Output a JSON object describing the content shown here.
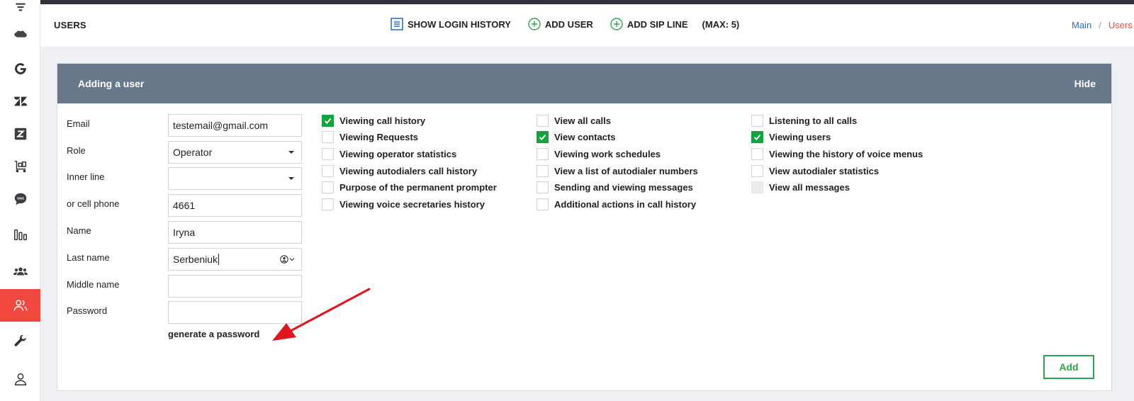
{
  "header": {
    "title": "USERS",
    "toolbar": {
      "show_login_history": "SHOW LOGIN HISTORY",
      "add_user": "ADD USER",
      "add_sip_line": "ADD SIP LINE",
      "max": "(MAX: 5)"
    },
    "breadcrumb": {
      "main": "Main",
      "separator": "/",
      "current": "Users"
    }
  },
  "panel": {
    "title": "Adding a user",
    "hide": "Hide",
    "form": {
      "email": {
        "label": "Email",
        "value": "testemail@gmail.com"
      },
      "role": {
        "label": "Role",
        "value": "Operator"
      },
      "inner_line": {
        "label": "Inner line",
        "value": ""
      },
      "cell_phone": {
        "label": "or cell phone",
        "value": "4661"
      },
      "name": {
        "label": "Name",
        "value": "Iryna"
      },
      "last_name": {
        "label": "Last name",
        "value": "Serbeniuk"
      },
      "middle_name": {
        "label": "Middle name",
        "value": ""
      },
      "password": {
        "label": "Password",
        "value": ""
      },
      "generate_password": "generate a password"
    },
    "permissions": [
      {
        "label": "Viewing call history",
        "checked": true
      },
      {
        "label": "Viewing Requests",
        "checked": false
      },
      {
        "label": "Viewing operator statistics",
        "checked": false
      },
      {
        "label": "Viewing autodialers call history",
        "checked": false
      },
      {
        "label": "Purpose of the permanent prompter",
        "checked": false
      },
      {
        "label": "Viewing voice secretaries history",
        "checked": false
      },
      {
        "label": "View all calls",
        "checked": false
      },
      {
        "label": "View contacts",
        "checked": true
      },
      {
        "label": "Viewing work schedules",
        "checked": false
      },
      {
        "label": "View a list of autodialer numbers",
        "checked": false
      },
      {
        "label": "Sending and viewing messages",
        "checked": false
      },
      {
        "label": "Additional actions in call history",
        "checked": false
      },
      {
        "label": "Listening to all calls",
        "checked": false
      },
      {
        "label": "Viewing users",
        "checked": true
      },
      {
        "label": "Viewing the history of voice menus",
        "checked": false
      },
      {
        "label": "View autodialer statistics",
        "checked": false
      },
      {
        "label": "View all messages",
        "checked": false,
        "disabled": true
      }
    ],
    "add_button": "Add"
  },
  "colors": {
    "accent": "#f0473e",
    "check": "#13a33f",
    "panel_header": "#66788a",
    "link": "#2a6fd6",
    "add": "#2da64b",
    "annotation": "#e0161d"
  }
}
